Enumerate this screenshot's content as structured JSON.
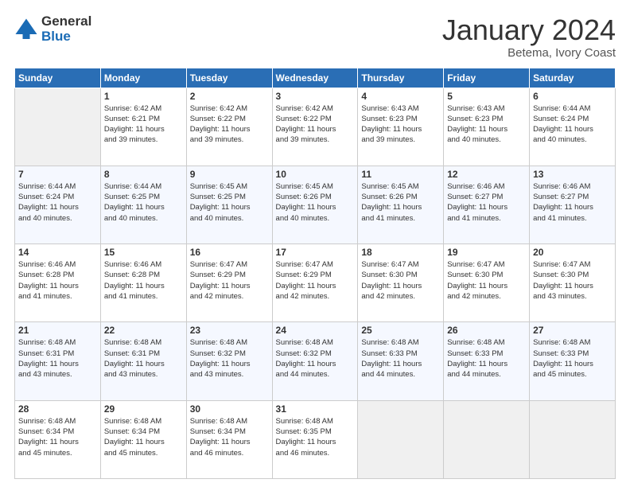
{
  "logo": {
    "general": "General",
    "blue": "Blue"
  },
  "header": {
    "title": "January 2024",
    "location": "Betema, Ivory Coast"
  },
  "weekdays": [
    "Sunday",
    "Monday",
    "Tuesday",
    "Wednesday",
    "Thursday",
    "Friday",
    "Saturday"
  ],
  "weeks": [
    [
      {
        "day": "",
        "info": ""
      },
      {
        "day": "1",
        "info": "Sunrise: 6:42 AM\nSunset: 6:21 PM\nDaylight: 11 hours\nand 39 minutes."
      },
      {
        "day": "2",
        "info": "Sunrise: 6:42 AM\nSunset: 6:22 PM\nDaylight: 11 hours\nand 39 minutes."
      },
      {
        "day": "3",
        "info": "Sunrise: 6:42 AM\nSunset: 6:22 PM\nDaylight: 11 hours\nand 39 minutes."
      },
      {
        "day": "4",
        "info": "Sunrise: 6:43 AM\nSunset: 6:23 PM\nDaylight: 11 hours\nand 39 minutes."
      },
      {
        "day": "5",
        "info": "Sunrise: 6:43 AM\nSunset: 6:23 PM\nDaylight: 11 hours\nand 40 minutes."
      },
      {
        "day": "6",
        "info": "Sunrise: 6:44 AM\nSunset: 6:24 PM\nDaylight: 11 hours\nand 40 minutes."
      }
    ],
    [
      {
        "day": "7",
        "info": "Sunrise: 6:44 AM\nSunset: 6:24 PM\nDaylight: 11 hours\nand 40 minutes."
      },
      {
        "day": "8",
        "info": "Sunrise: 6:44 AM\nSunset: 6:25 PM\nDaylight: 11 hours\nand 40 minutes."
      },
      {
        "day": "9",
        "info": "Sunrise: 6:45 AM\nSunset: 6:25 PM\nDaylight: 11 hours\nand 40 minutes."
      },
      {
        "day": "10",
        "info": "Sunrise: 6:45 AM\nSunset: 6:26 PM\nDaylight: 11 hours\nand 40 minutes."
      },
      {
        "day": "11",
        "info": "Sunrise: 6:45 AM\nSunset: 6:26 PM\nDaylight: 11 hours\nand 41 minutes."
      },
      {
        "day": "12",
        "info": "Sunrise: 6:46 AM\nSunset: 6:27 PM\nDaylight: 11 hours\nand 41 minutes."
      },
      {
        "day": "13",
        "info": "Sunrise: 6:46 AM\nSunset: 6:27 PM\nDaylight: 11 hours\nand 41 minutes."
      }
    ],
    [
      {
        "day": "14",
        "info": "Sunrise: 6:46 AM\nSunset: 6:28 PM\nDaylight: 11 hours\nand 41 minutes."
      },
      {
        "day": "15",
        "info": "Sunrise: 6:46 AM\nSunset: 6:28 PM\nDaylight: 11 hours\nand 41 minutes."
      },
      {
        "day": "16",
        "info": "Sunrise: 6:47 AM\nSunset: 6:29 PM\nDaylight: 11 hours\nand 42 minutes."
      },
      {
        "day": "17",
        "info": "Sunrise: 6:47 AM\nSunset: 6:29 PM\nDaylight: 11 hours\nand 42 minutes."
      },
      {
        "day": "18",
        "info": "Sunrise: 6:47 AM\nSunset: 6:30 PM\nDaylight: 11 hours\nand 42 minutes."
      },
      {
        "day": "19",
        "info": "Sunrise: 6:47 AM\nSunset: 6:30 PM\nDaylight: 11 hours\nand 42 minutes."
      },
      {
        "day": "20",
        "info": "Sunrise: 6:47 AM\nSunset: 6:30 PM\nDaylight: 11 hours\nand 43 minutes."
      }
    ],
    [
      {
        "day": "21",
        "info": "Sunrise: 6:48 AM\nSunset: 6:31 PM\nDaylight: 11 hours\nand 43 minutes."
      },
      {
        "day": "22",
        "info": "Sunrise: 6:48 AM\nSunset: 6:31 PM\nDaylight: 11 hours\nand 43 minutes."
      },
      {
        "day": "23",
        "info": "Sunrise: 6:48 AM\nSunset: 6:32 PM\nDaylight: 11 hours\nand 43 minutes."
      },
      {
        "day": "24",
        "info": "Sunrise: 6:48 AM\nSunset: 6:32 PM\nDaylight: 11 hours\nand 44 minutes."
      },
      {
        "day": "25",
        "info": "Sunrise: 6:48 AM\nSunset: 6:33 PM\nDaylight: 11 hours\nand 44 minutes."
      },
      {
        "day": "26",
        "info": "Sunrise: 6:48 AM\nSunset: 6:33 PM\nDaylight: 11 hours\nand 44 minutes."
      },
      {
        "day": "27",
        "info": "Sunrise: 6:48 AM\nSunset: 6:33 PM\nDaylight: 11 hours\nand 45 minutes."
      }
    ],
    [
      {
        "day": "28",
        "info": "Sunrise: 6:48 AM\nSunset: 6:34 PM\nDaylight: 11 hours\nand 45 minutes."
      },
      {
        "day": "29",
        "info": "Sunrise: 6:48 AM\nSunset: 6:34 PM\nDaylight: 11 hours\nand 45 minutes."
      },
      {
        "day": "30",
        "info": "Sunrise: 6:48 AM\nSunset: 6:34 PM\nDaylight: 11 hours\nand 46 minutes."
      },
      {
        "day": "31",
        "info": "Sunrise: 6:48 AM\nSunset: 6:35 PM\nDaylight: 11 hours\nand 46 minutes."
      },
      {
        "day": "",
        "info": ""
      },
      {
        "day": "",
        "info": ""
      },
      {
        "day": "",
        "info": ""
      }
    ]
  ]
}
